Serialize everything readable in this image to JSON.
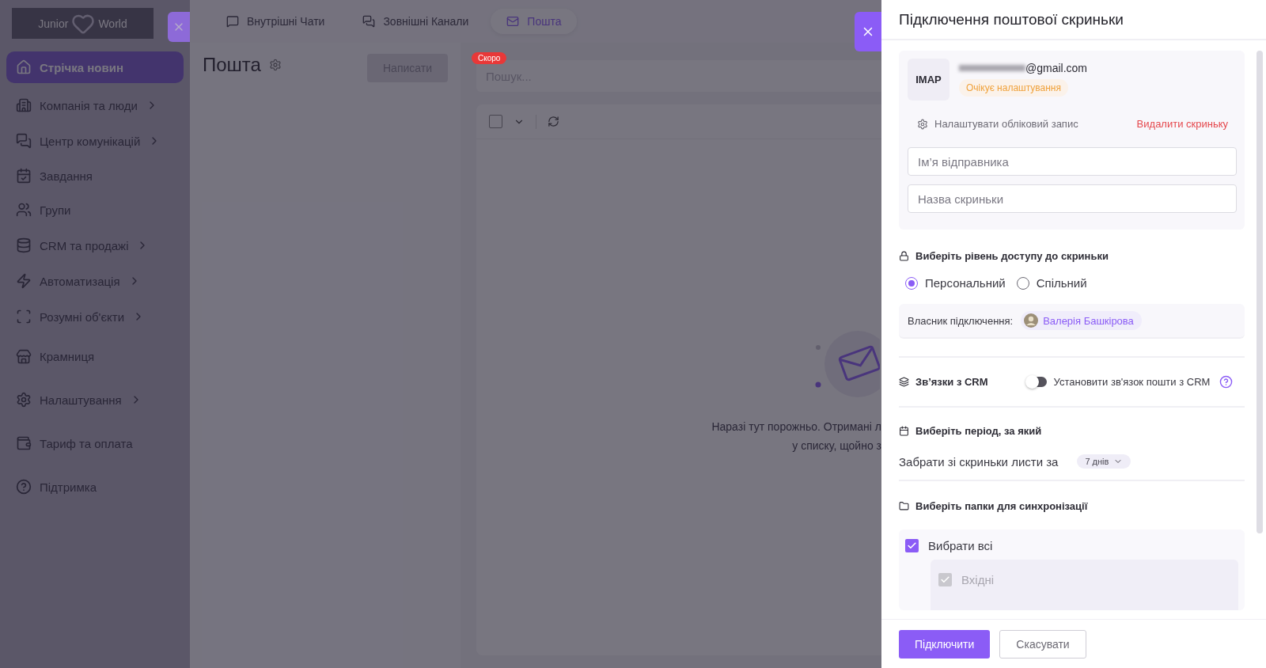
{
  "sidebar": {
    "logo": {
      "left": "Junior",
      "right": "World"
    },
    "items": [
      {
        "label": "Стрічка новин",
        "selected": true,
        "submenu": false
      },
      {
        "label": "Компанія та люди",
        "selected": false,
        "submenu": true
      },
      {
        "label": "Центр комунікацій",
        "selected": false,
        "submenu": true
      },
      {
        "label": "Завдання",
        "selected": false,
        "submenu": false
      },
      {
        "label": "Групи",
        "selected": false,
        "submenu": false
      },
      {
        "label": "CRM та продажі",
        "selected": false,
        "submenu": true
      },
      {
        "label": "Автоматизація",
        "selected": false,
        "submenu": true
      },
      {
        "label": "Розумні об'єкти",
        "selected": false,
        "submenu": true
      },
      {
        "label": "Крамниця",
        "selected": false,
        "submenu": false
      },
      {
        "label": "Налаштування",
        "selected": false,
        "submenu": true
      },
      {
        "label": "Тариф та оплата",
        "selected": false,
        "submenu": false
      },
      {
        "label": "Підтримка",
        "selected": false,
        "submenu": false
      }
    ]
  },
  "tabs": [
    {
      "label": "Внутрішні Чати",
      "selected": false
    },
    {
      "label": "Зовнішні Канали",
      "selected": false
    },
    {
      "label": "Пошта",
      "selected": true
    }
  ],
  "mail_pane": {
    "title": "Пошта",
    "compose": "Написати"
  },
  "search": {
    "badge": "Скоро",
    "placeholder": "Пошук..."
  },
  "list_toolbar": {
    "select_all_checked": false
  },
  "empty_state": {
    "lines": [
      "Наразі тут порожньо. Отримані л",
      "у списку, щойно з"
    ]
  },
  "drawer": {
    "title": "Підключення поштової скриньки",
    "account": {
      "protocol": "IMAP",
      "email": "@gmail.com",
      "status": "Очікує налаштування",
      "settings": "Налаштувати обліковий запис",
      "delete": "Видалити скриньку",
      "fields": [
        {
          "placeholder": "Ім’я відправника"
        },
        {
          "placeholder": "Назва скриньки"
        }
      ]
    },
    "access": {
      "heading": "Виберіть рівень доступу до скриньки",
      "options": [
        {
          "label": "Персональний",
          "selected": true
        },
        {
          "label": "Спільний",
          "selected": false
        }
      ],
      "owner_label": "Власник підключення:",
      "owner": "Валерія Башкірова"
    },
    "crm": {
      "heading": "Зв’язки з CRM",
      "toggle_label": "Установити зв'язок пошти з CRM",
      "on": false
    },
    "period": {
      "heading": "Виберіть період, за який",
      "label": "Забрати зі скриньки листи за",
      "value": "7 днів"
    },
    "folders": {
      "heading": "Виберіть папки для синхронізації",
      "select_all": {
        "label": "Вибрати всі",
        "checked": true
      },
      "items": [
        {
          "label": "Вхідні",
          "checked": true,
          "disabled": true
        }
      ]
    },
    "buttons": {
      "primary": "Підключити",
      "secondary": "Скасувати"
    }
  }
}
